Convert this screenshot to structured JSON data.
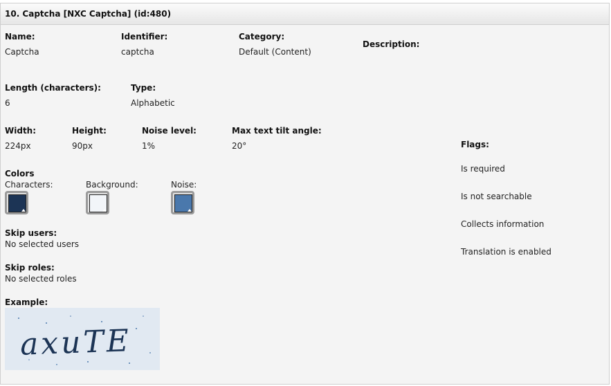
{
  "header": {
    "title": "10. Captcha [NXC Captcha] (id:480)"
  },
  "fields": {
    "name": {
      "label": "Name:",
      "value": "Captcha"
    },
    "identifier": {
      "label": "Identifier:",
      "value": "captcha"
    },
    "category": {
      "label": "Category:",
      "value": "Default (Content)"
    },
    "description": {
      "label": "Description:"
    },
    "length": {
      "label": "Length (characters):",
      "value": "6"
    },
    "type": {
      "label": "Type:",
      "value": "Alphabetic"
    },
    "width": {
      "label": "Width:",
      "value": "224px"
    },
    "height": {
      "label": "Height:",
      "value": "90px"
    },
    "noise_level": {
      "label": "Noise level:",
      "value": "1%"
    },
    "max_tilt": {
      "label": "Max text tilt angle:",
      "value": "20°"
    }
  },
  "colors": {
    "title": "Colors",
    "characters": {
      "label": "Characters:",
      "color": "#1c3455"
    },
    "background": {
      "label": "Background:",
      "color": "#f2f5f9"
    },
    "noise": {
      "label": "Noise:",
      "color": "#4a78ac"
    }
  },
  "skip_users": {
    "label": "Skip users:",
    "value": "No selected users"
  },
  "skip_roles": {
    "label": "Skip roles:",
    "value": "No selected roles"
  },
  "example": {
    "label": "Example:",
    "captcha_text": "axuTE"
  },
  "flags": {
    "label": "Flags:",
    "items": [
      "Is required",
      "Is not searchable",
      "Collects information",
      "Translation is enabled"
    ]
  }
}
